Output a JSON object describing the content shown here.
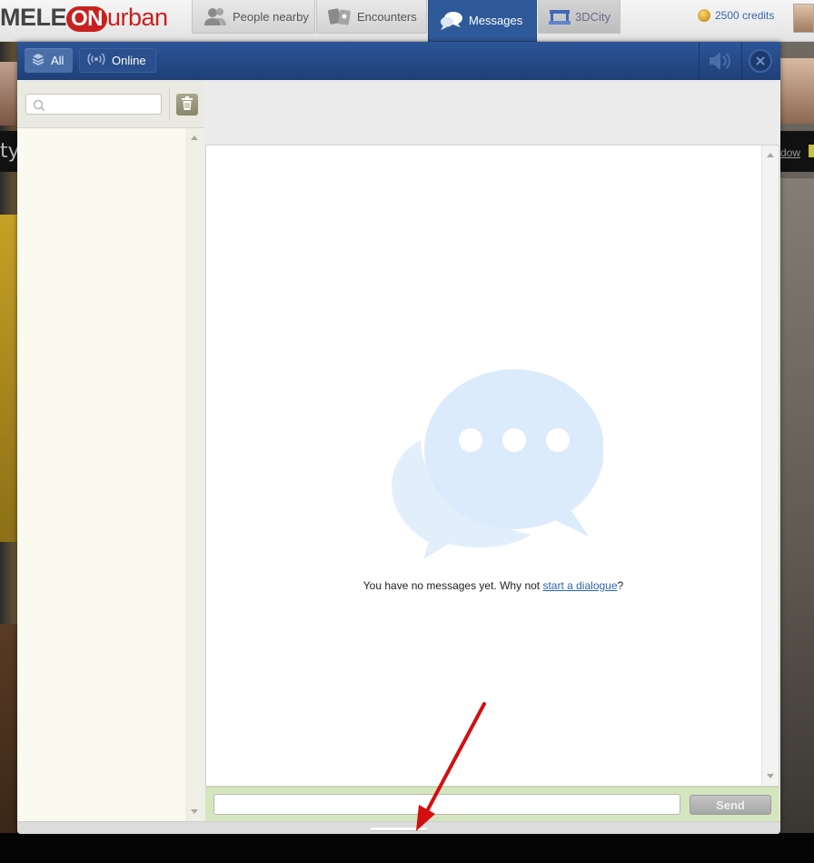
{
  "site": {
    "logo": {
      "part1": "MELE",
      "part2": "ON",
      "part3": "urban"
    },
    "nav": [
      {
        "label": "People nearby",
        "icon": "people-icon"
      },
      {
        "label": "Encounters",
        "icon": "encounters-icon"
      },
      {
        "label": "Messages",
        "icon": "speech-bubbles-icon",
        "active": true
      },
      {
        "label": "3DCity",
        "icon": "3dcity-icon"
      }
    ],
    "credits": "2500 credits",
    "left_band_text": "ty",
    "right_band_text": "dow"
  },
  "messenger": {
    "filters": {
      "all_label": "All",
      "online_label": "Online"
    },
    "search": {
      "value": "",
      "placeholder": ""
    },
    "empty_state": {
      "prefix": "You have no messages yet. Why not ",
      "link": "start a dialogue",
      "suffix": "?"
    },
    "compose": {
      "value": "",
      "placeholder": "",
      "send_label": "Send"
    }
  },
  "colors": {
    "header_blue": "#2d5597",
    "accent_red": "#c8201e",
    "link_blue": "#2b66b3",
    "compose_green": "#d5e6bf",
    "bubble_blue": "#dcebfb",
    "annotation_red": "#d40f0f"
  }
}
